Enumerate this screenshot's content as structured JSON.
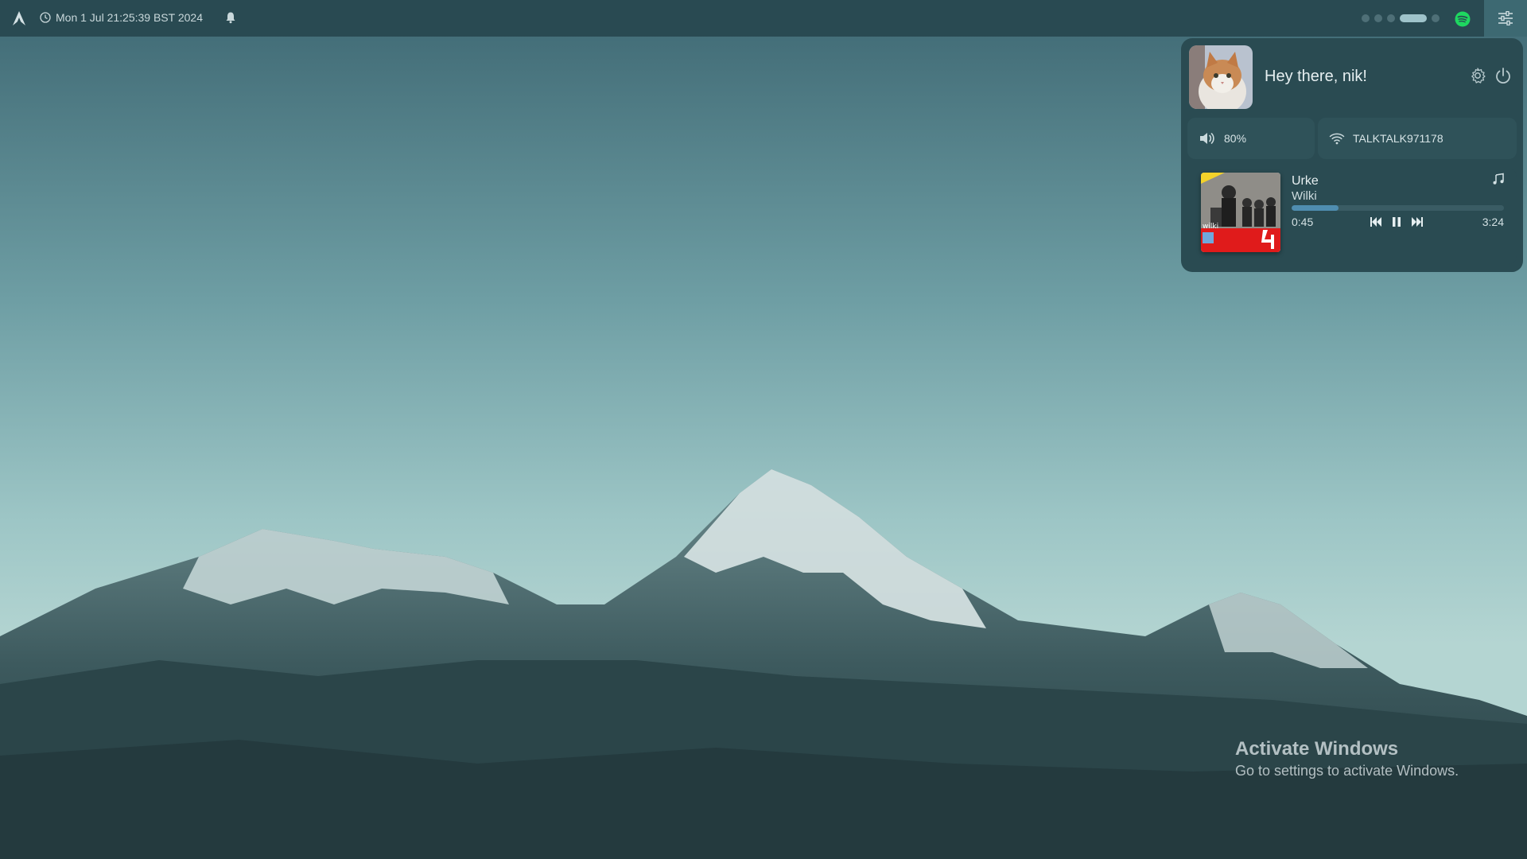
{
  "topbar": {
    "logo_icon": "arch-linux-icon",
    "clock_text": "Mon  1 Jul 21:25:39 BST 2024",
    "clock_icon": "clock-icon",
    "bell_icon": "bell-icon",
    "workspaces": [
      {
        "active": false
      },
      {
        "active": false
      },
      {
        "active": false
      },
      {
        "active": true
      },
      {
        "active": false
      }
    ],
    "spotify_icon": "spotify-icon",
    "settings_icon": "sliders-icon"
  },
  "panel": {
    "greeting": "Hey there, nik!",
    "volume_label": "80%",
    "wifi_label": "TALKTALK971178",
    "media": {
      "title": "Urke",
      "artist": "Wilki",
      "elapsed": "0:45",
      "total": "3:24",
      "progress": 0.22
    }
  },
  "watermark": {
    "title": "Activate Windows",
    "subtitle": "Go to settings to activate Windows."
  },
  "colors": {
    "bar": "#294a52",
    "panel": "#2a4b52",
    "accent": "#4f8db0",
    "spotify": "#1ed760"
  }
}
